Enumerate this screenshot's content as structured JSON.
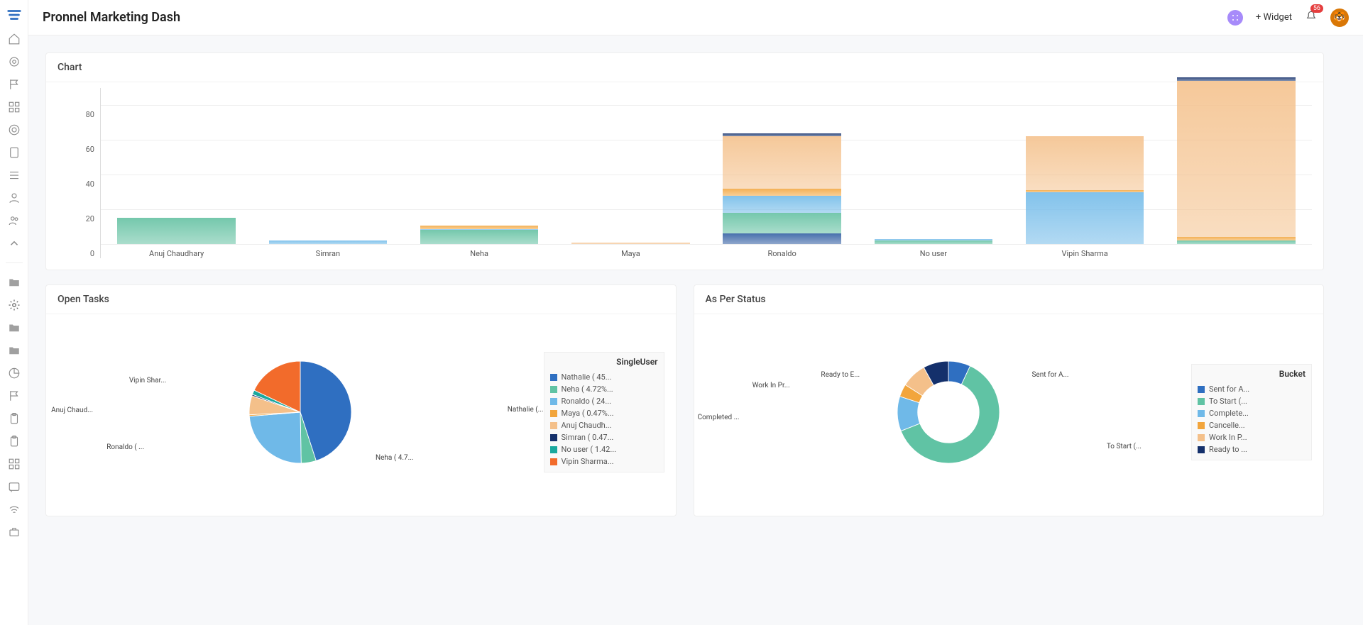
{
  "header": {
    "title": "Pronnel Marketing Dash",
    "widget_btn": "+ Widget",
    "notif_count": "56"
  },
  "cards": {
    "chart1_title": "Chart",
    "chart2_title": "Open Tasks",
    "chart3_title": "As Per Status"
  },
  "chart_data": [
    {
      "type": "bar",
      "stacked": true,
      "title": "Chart",
      "xlabel": "",
      "ylabel": "",
      "ylim": [
        0,
        90
      ],
      "y_ticks": [
        0,
        20,
        40,
        60,
        80
      ],
      "categories": [
        "Anuj Chaudhary",
        "Simran",
        "Neha",
        "Maya",
        "Ronaldo",
        "No user",
        "Vipin Sharma",
        ""
      ],
      "series_order": [
        "Sent for A...",
        "To Start",
        "Completed",
        "Cancelled",
        "Work In Pr...",
        "Ready to E..."
      ],
      "colors": {
        "Sent for A...": "#2c5aa0",
        "To Start": "#5fbf9f",
        "Completed": "#6fb9e8",
        "Cancelled": "#f2a53c",
        "Work In Pr...": "#f4c08a",
        "Ready to E...": "#14306b"
      },
      "stacks": [
        {
          "Sent for A...": 0,
          "To Start": 15,
          "Completed": 0,
          "Cancelled": 0,
          "Work In Pr...": 0,
          "Ready to E...": 0
        },
        {
          "Sent for A...": 0,
          "To Start": 0,
          "Completed": 2,
          "Cancelled": 0,
          "Work In Pr...": 0,
          "Ready to E...": 0
        },
        {
          "Sent for A...": 0,
          "To Start": 8,
          "Completed": 0.5,
          "Cancelled": 2,
          "Work In Pr...": 0,
          "Ready to E...": 0
        },
        {
          "Sent for A...": 0,
          "To Start": 0,
          "Completed": 0,
          "Cancelled": 0,
          "Work In Pr...": 1,
          "Ready to E...": 0
        },
        {
          "Sent for A...": 6,
          "To Start": 12,
          "Completed": 10,
          "Cancelled": 4,
          "Work In Pr...": 30,
          "Ready to E...": 2
        },
        {
          "Sent for A...": 0,
          "To Start": 2,
          "Completed": 1,
          "Cancelled": 0,
          "Work In Pr...": 0,
          "Ready to E...": 0
        },
        {
          "Sent for A...": 0,
          "To Start": 0,
          "Completed": 30,
          "Cancelled": 1,
          "Work In Pr...": 31,
          "Ready to E...": 0
        },
        {
          "Sent for A...": 0,
          "To Start": 2,
          "Completed": 0,
          "Cancelled": 2,
          "Work In Pr...": 92,
          "Ready to E...": 2
        }
      ]
    },
    {
      "type": "pie",
      "title": "Open Tasks",
      "legend_title": "SingleUser",
      "slices": [
        {
          "label": "Nathalie ( 45...",
          "value": 45.0,
          "color": "#2f6fc1",
          "callout": "Nathalie (..."
        },
        {
          "label": "Neha ( 4.72%...",
          "value": 4.72,
          "color": "#60c3a4",
          "callout": "Neha ( 4.7..."
        },
        {
          "label": "Ronaldo ( 24...",
          "value": 24.0,
          "color": "#6fb9e8",
          "callout": "Ronaldo ( ..."
        },
        {
          "label": "Maya ( 0.47%...",
          "value": 0.47,
          "color": "#f2a53c",
          "callout": ""
        },
        {
          "label": "Anuj Chaudh...",
          "value": 6.0,
          "color": "#f4c08a",
          "callout": "Anuj Chaud..."
        },
        {
          "label": "Simran ( 0.47...",
          "value": 0.47,
          "color": "#14306b",
          "callout": ""
        },
        {
          "label": "No user ( 1.42...",
          "value": 1.42,
          "color": "#1aa89e",
          "callout": ""
        },
        {
          "label": "Vipin Sharma...",
          "value": 17.92,
          "color": "#f26b2b",
          "callout": "Vipin Shar..."
        }
      ]
    },
    {
      "type": "pie",
      "donut": true,
      "title": "As Per Status",
      "legend_title": "Bucket",
      "slices": [
        {
          "label": "Sent for A...",
          "value": 7,
          "color": "#2f6fc1",
          "callout": "Sent for A..."
        },
        {
          "label": "To Start (...",
          "value": 62,
          "color": "#60c3a4",
          "callout": "To Start (..."
        },
        {
          "label": "Complete...",
          "value": 11,
          "color": "#6fb9e8",
          "callout": "Completed ..."
        },
        {
          "label": "Cancelle...",
          "value": 4,
          "color": "#f2a53c",
          "callout": ""
        },
        {
          "label": "Work In P...",
          "value": 8,
          "color": "#f4c08a",
          "callout": "Work In Pr..."
        },
        {
          "label": "Ready to ...",
          "value": 8,
          "color": "#14306b",
          "callout": "Ready to E..."
        }
      ]
    }
  ]
}
